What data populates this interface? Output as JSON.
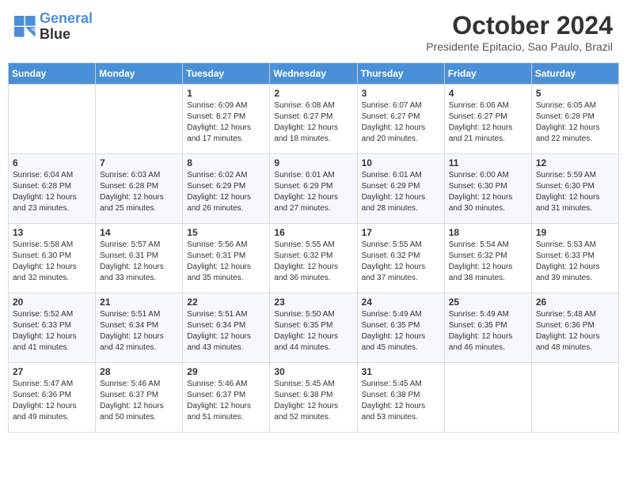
{
  "header": {
    "logo_line1": "General",
    "logo_line2": "Blue",
    "month_title": "October 2024",
    "location": "Presidente Epitacio, Sao Paulo, Brazil"
  },
  "days_of_week": [
    "Sunday",
    "Monday",
    "Tuesday",
    "Wednesday",
    "Thursday",
    "Friday",
    "Saturday"
  ],
  "weeks": [
    [
      {
        "day": "",
        "info": ""
      },
      {
        "day": "",
        "info": ""
      },
      {
        "day": "1",
        "info": "Sunrise: 6:09 AM\nSunset: 6:27 PM\nDaylight: 12 hours and 17 minutes."
      },
      {
        "day": "2",
        "info": "Sunrise: 6:08 AM\nSunset: 6:27 PM\nDaylight: 12 hours and 18 minutes."
      },
      {
        "day": "3",
        "info": "Sunrise: 6:07 AM\nSunset: 6:27 PM\nDaylight: 12 hours and 20 minutes."
      },
      {
        "day": "4",
        "info": "Sunrise: 6:06 AM\nSunset: 6:27 PM\nDaylight: 12 hours and 21 minutes."
      },
      {
        "day": "5",
        "info": "Sunrise: 6:05 AM\nSunset: 6:28 PM\nDaylight: 12 hours and 22 minutes."
      }
    ],
    [
      {
        "day": "6",
        "info": "Sunrise: 6:04 AM\nSunset: 6:28 PM\nDaylight: 12 hours and 23 minutes."
      },
      {
        "day": "7",
        "info": "Sunrise: 6:03 AM\nSunset: 6:28 PM\nDaylight: 12 hours and 25 minutes."
      },
      {
        "day": "8",
        "info": "Sunrise: 6:02 AM\nSunset: 6:29 PM\nDaylight: 12 hours and 26 minutes."
      },
      {
        "day": "9",
        "info": "Sunrise: 6:01 AM\nSunset: 6:29 PM\nDaylight: 12 hours and 27 minutes."
      },
      {
        "day": "10",
        "info": "Sunrise: 6:01 AM\nSunset: 6:29 PM\nDaylight: 12 hours and 28 minutes."
      },
      {
        "day": "11",
        "info": "Sunrise: 6:00 AM\nSunset: 6:30 PM\nDaylight: 12 hours and 30 minutes."
      },
      {
        "day": "12",
        "info": "Sunrise: 5:59 AM\nSunset: 6:30 PM\nDaylight: 12 hours and 31 minutes."
      }
    ],
    [
      {
        "day": "13",
        "info": "Sunrise: 5:58 AM\nSunset: 6:30 PM\nDaylight: 12 hours and 32 minutes."
      },
      {
        "day": "14",
        "info": "Sunrise: 5:57 AM\nSunset: 6:31 PM\nDaylight: 12 hours and 33 minutes."
      },
      {
        "day": "15",
        "info": "Sunrise: 5:56 AM\nSunset: 6:31 PM\nDaylight: 12 hours and 35 minutes."
      },
      {
        "day": "16",
        "info": "Sunrise: 5:55 AM\nSunset: 6:32 PM\nDaylight: 12 hours and 36 minutes."
      },
      {
        "day": "17",
        "info": "Sunrise: 5:55 AM\nSunset: 6:32 PM\nDaylight: 12 hours and 37 minutes."
      },
      {
        "day": "18",
        "info": "Sunrise: 5:54 AM\nSunset: 6:32 PM\nDaylight: 12 hours and 38 minutes."
      },
      {
        "day": "19",
        "info": "Sunrise: 5:53 AM\nSunset: 6:33 PM\nDaylight: 12 hours and 39 minutes."
      }
    ],
    [
      {
        "day": "20",
        "info": "Sunrise: 5:52 AM\nSunset: 6:33 PM\nDaylight: 12 hours and 41 minutes."
      },
      {
        "day": "21",
        "info": "Sunrise: 5:51 AM\nSunset: 6:34 PM\nDaylight: 12 hours and 42 minutes."
      },
      {
        "day": "22",
        "info": "Sunrise: 5:51 AM\nSunset: 6:34 PM\nDaylight: 12 hours and 43 minutes."
      },
      {
        "day": "23",
        "info": "Sunrise: 5:50 AM\nSunset: 6:35 PM\nDaylight: 12 hours and 44 minutes."
      },
      {
        "day": "24",
        "info": "Sunrise: 5:49 AM\nSunset: 6:35 PM\nDaylight: 12 hours and 45 minutes."
      },
      {
        "day": "25",
        "info": "Sunrise: 5:49 AM\nSunset: 6:35 PM\nDaylight: 12 hours and 46 minutes."
      },
      {
        "day": "26",
        "info": "Sunrise: 5:48 AM\nSunset: 6:36 PM\nDaylight: 12 hours and 48 minutes."
      }
    ],
    [
      {
        "day": "27",
        "info": "Sunrise: 5:47 AM\nSunset: 6:36 PM\nDaylight: 12 hours and 49 minutes."
      },
      {
        "day": "28",
        "info": "Sunrise: 5:46 AM\nSunset: 6:37 PM\nDaylight: 12 hours and 50 minutes."
      },
      {
        "day": "29",
        "info": "Sunrise: 5:46 AM\nSunset: 6:37 PM\nDaylight: 12 hours and 51 minutes."
      },
      {
        "day": "30",
        "info": "Sunrise: 5:45 AM\nSunset: 6:38 PM\nDaylight: 12 hours and 52 minutes."
      },
      {
        "day": "31",
        "info": "Sunrise: 5:45 AM\nSunset: 6:38 PM\nDaylight: 12 hours and 53 minutes."
      },
      {
        "day": "",
        "info": ""
      },
      {
        "day": "",
        "info": ""
      }
    ]
  ]
}
